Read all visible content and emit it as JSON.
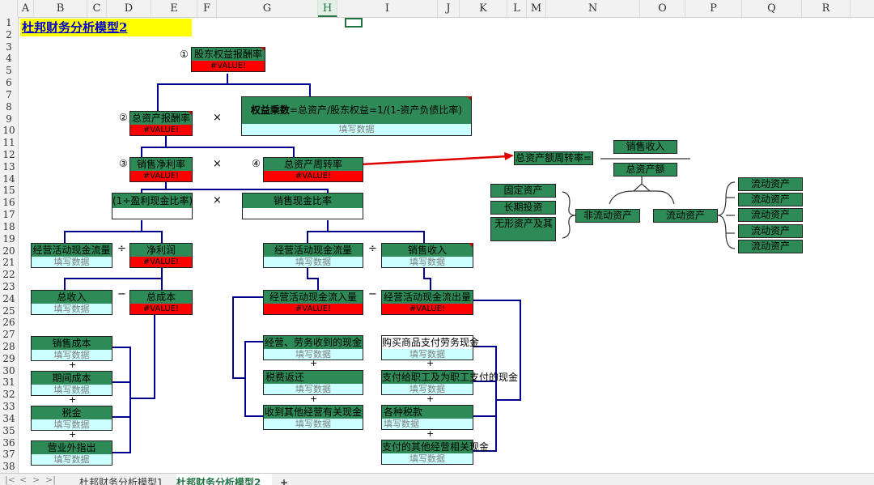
{
  "columns": [
    "A",
    "B",
    "C",
    "D",
    "E",
    "F",
    "G",
    "H",
    "I",
    "J",
    "K",
    "L",
    "M",
    "N",
    "O",
    "P",
    "Q",
    "R"
  ],
  "rows": [
    "1",
    "2",
    "3",
    "4",
    "5",
    "6",
    "7",
    "8",
    "9",
    "10",
    "11",
    "12",
    "13",
    "14",
    "15",
    "16",
    "17",
    "18",
    "19",
    "20",
    "21",
    "22",
    "23",
    "24",
    "25",
    "26",
    "27",
    "28",
    "29",
    "30",
    "31",
    "32",
    "33",
    "34",
    "35",
    "36",
    "37",
    "38"
  ],
  "selected_column": "H",
  "title": "杜邦财务分析模型2",
  "labels": {
    "roe_num": "①",
    "roe": "股东权益报酬率",
    "roa_num": "②",
    "roa": "总资产报酬率",
    "equity_mult_prefix": "权益乘数",
    "equity_mult_formula": "=总资产/股东权益=1/(1-资产负债比率)",
    "npm_num": "③",
    "npm": "销售净利率",
    "turnover_num": "④",
    "turnover": "总资产周转率",
    "cash_ratio": "(1÷盈利现金比率)",
    "sales_cash": "销售现金比率",
    "op_cashflow": "经营活动现金流量",
    "net_profit": "净利润",
    "op_cashflow2": "经营活动现金流量",
    "sales_rev": "销售收入",
    "total_rev": "总收入",
    "total_cost": "总成本",
    "op_inflow": "经营活动现金流入量",
    "op_outflow": "经营活动现金流出量",
    "cost_of_sales": "销售成本",
    "period_cost": "期间成本",
    "tax": "税金",
    "non_op": "营业外指出",
    "cash_from_sales": "经营、劳务收到的现金",
    "tax_refund": "税费返还",
    "other_op_in": "收到其他经营有关现金",
    "pay_goods": "购买商品支付劳务现金",
    "pay_staff": "支付给职工及为职工支付的现金",
    "taxes_paid": "各种税款",
    "other_op_out": "支付的其他经营相关现金",
    "turnover_def": "总资产额周转率=",
    "sales_rev_top": "销售收入",
    "total_assets": "总资产额",
    "fixed_assets": "固定资产",
    "lt_invest": "长期投资",
    "intangible": "无形资产及其",
    "non_current": "非流动资产",
    "current": "流动资产",
    "current_items": [
      "流动资产",
      "流动资产",
      "流动资产",
      "流动资产",
      "流动资产"
    ]
  },
  "values": {
    "value_error": "#VALUE!",
    "fill_in": "填写数据"
  },
  "operators": {
    "times": "×",
    "divide": "÷",
    "minus": "−",
    "plus": "+"
  },
  "sheet_tabs": [
    "杜邦财务分析模型1",
    "杜邦财务分析模型2"
  ],
  "active_tab": "杜邦财务分析模型2",
  "add_sheet": "+",
  "nav": [
    "|<",
    "<",
    ">",
    ">|"
  ],
  "colors": {
    "header_green": "#2e8b57",
    "error_red": "#ff0000",
    "fill_cyan": "#ccffff",
    "title_yellow": "#ffff00",
    "connector_navy": "#00008b",
    "arrow_red": "#e00000"
  }
}
